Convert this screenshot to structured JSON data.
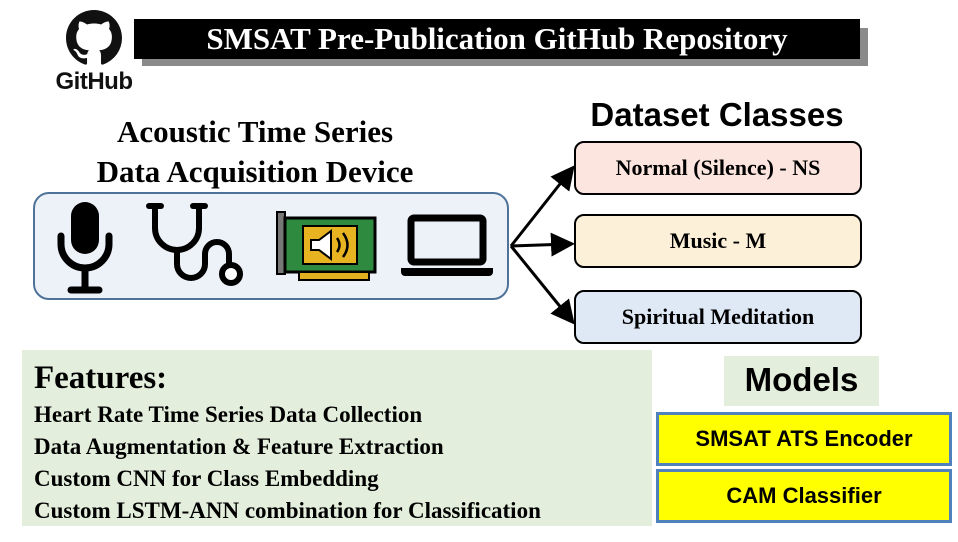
{
  "title": "SMSAT Pre-Publication GitHub Repository",
  "logo": {
    "icon": "github-octocat-icon",
    "wordmark": "GitHub"
  },
  "device": {
    "heading_line1": "Acoustic Time Series",
    "heading_line2": "Data Acquisition Device",
    "icons": [
      "microphone-icon",
      "stethoscope-icon",
      "sound-card-icon",
      "laptop-icon"
    ]
  },
  "dataset": {
    "heading": "Dataset Classes",
    "classes": [
      {
        "label": "Normal (Silence) - NS",
        "color": "#fce5de"
      },
      {
        "label": "Music - M",
        "color": "#fdf0d9"
      },
      {
        "label": "Spiritual Meditation",
        "color": "#dfe8f5"
      }
    ]
  },
  "features": {
    "heading": "Features:",
    "items": [
      "Heart Rate Time Series Data Collection",
      "Data Augmentation & Feature Extraction",
      "Custom CNN for Class Embedding",
      "Custom LSTM-ANN combination for Classification"
    ]
  },
  "models": {
    "heading": "Models",
    "items": [
      "SMSAT ATS Encoder",
      "CAM Classifier"
    ],
    "fill_color": "#ffff00",
    "border_color": "#4f81bd"
  }
}
